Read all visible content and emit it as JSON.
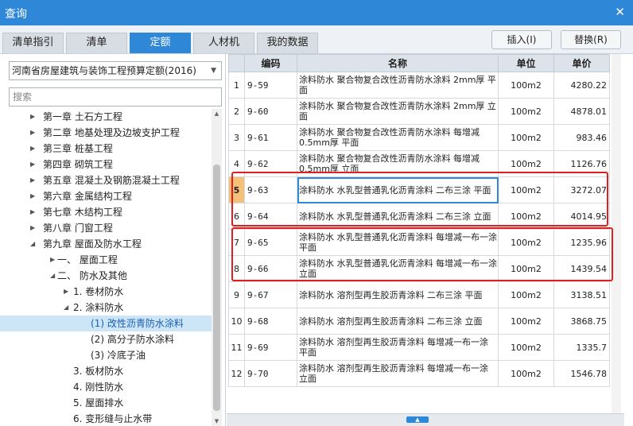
{
  "window": {
    "title": "查询",
    "close_glyph": "✕"
  },
  "tabs": [
    {
      "label": "清单指引",
      "active": false
    },
    {
      "label": "清单",
      "active": false
    },
    {
      "label": "定额",
      "active": true
    },
    {
      "label": "人材机",
      "active": false
    },
    {
      "label": "我的数据",
      "active": false
    }
  ],
  "toolbar": {
    "insert_label": "插入(I)",
    "replace_label": "替换(R)"
  },
  "left": {
    "quota_book": "河南省房屋建筑与装饰工程预算定额(2016)",
    "search_placeholder": "搜索",
    "tree": [
      {
        "label": "第一章 土石方工程",
        "twisty": "▶",
        "level": 0
      },
      {
        "label": "第二章 地基处理及边坡支护工程",
        "twisty": "▶",
        "level": 0
      },
      {
        "label": "第三章 桩基工程",
        "twisty": "▶",
        "level": 0
      },
      {
        "label": "第四章 砌筑工程",
        "twisty": "▶",
        "level": 0
      },
      {
        "label": "第五章 混凝土及钢筋混凝土工程",
        "twisty": "▶",
        "level": 0
      },
      {
        "label": "第六章 金属结构工程",
        "twisty": "▶",
        "level": 0
      },
      {
        "label": "第七章 木结构工程",
        "twisty": "▶",
        "level": 0
      },
      {
        "label": "第八章 门窗工程",
        "twisty": "▶",
        "level": 0
      },
      {
        "label": "第九章 屋面及防水工程",
        "twisty": "◢",
        "level": 0
      },
      {
        "label": "一、 屋面工程",
        "twisty": "▶",
        "level": 1
      },
      {
        "label": "二、 防水及其他",
        "twisty": "◢",
        "level": 1
      },
      {
        "label": "1. 卷材防水",
        "twisty": "▶",
        "level": 2
      },
      {
        "label": "2. 涂料防水",
        "twisty": "◢",
        "level": 2
      },
      {
        "label": "(1) 改性沥青防水涂料",
        "twisty": "",
        "level": 3,
        "selected": true
      },
      {
        "label": "(2) 高分子防水涂料",
        "twisty": "",
        "level": 3
      },
      {
        "label": "(3) 冷底子油",
        "twisty": "",
        "level": 3
      },
      {
        "label": "3. 板材防水",
        "twisty": "",
        "level": 2
      },
      {
        "label": "4. 刚性防水",
        "twisty": "",
        "level": 2
      },
      {
        "label": "5. 屋面排水",
        "twisty": "",
        "level": 2
      },
      {
        "label": "6. 变形缝与止水带",
        "twisty": "",
        "level": 2
      }
    ]
  },
  "grid": {
    "headers": [
      "",
      "编码",
      "名称",
      "单位",
      "单价"
    ],
    "rows": [
      {
        "no": "1",
        "code": "9-59",
        "name": "涂料防水 聚合物复合改性沥青防水涂料 2mm厚 平面",
        "unit": "100m2",
        "price": "4280.22"
      },
      {
        "no": "2",
        "code": "9-60",
        "name": "涂料防水 聚合物复合改性沥青防水涂料 2mm厚 立面",
        "unit": "100m2",
        "price": "4878.01"
      },
      {
        "no": "3",
        "code": "9-61",
        "name": "涂料防水 聚合物复合改性沥青防水涂料 每增减0.5mm厚 平面",
        "unit": "100m2",
        "price": "983.46"
      },
      {
        "no": "4",
        "code": "9-62",
        "name": "涂料防水 聚合物复合改性沥青防水涂料 每增减0.5mm厚 立面",
        "unit": "100m2",
        "price": "1126.76"
      },
      {
        "no": "5",
        "code": "9-63",
        "name": "涂料防水 水乳型普通乳化沥青涂料 二布三涂 平面",
        "unit": "100m2",
        "price": "3272.07"
      },
      {
        "no": "6",
        "code": "9-64",
        "name": "涂料防水 水乳型普通乳化沥青涂料 二布三涂 立面",
        "unit": "100m2",
        "price": "4014.95"
      },
      {
        "no": "7",
        "code": "9-65",
        "name": "涂料防水 水乳型普通乳化沥青涂料 每增减一布一涂 平面",
        "unit": "100m2",
        "price": "1235.96"
      },
      {
        "no": "8",
        "code": "9-66",
        "name": "涂料防水 水乳型普通乳化沥青涂料 每增减一布一涂 立面",
        "unit": "100m2",
        "price": "1439.54"
      },
      {
        "no": "9",
        "code": "9-67",
        "name": "涂料防水 溶剂型再生胶沥青涂料 二布三涂 平面",
        "unit": "100m2",
        "price": "3138.51"
      },
      {
        "no": "10",
        "code": "9-68",
        "name": "涂料防水 溶剂型再生胶沥青涂料 二布三涂 立面",
        "unit": "100m2",
        "price": "3868.75"
      },
      {
        "no": "11",
        "code": "9-69",
        "name": "涂料防水 溶剂型再生胶沥青涂料 每增减一布一涂 平面",
        "unit": "100m2",
        "price": "1335.7"
      },
      {
        "no": "12",
        "code": "9-70",
        "name": "涂料防水 溶剂型再生胶沥青涂料 每增减一布一涂 立面",
        "unit": "100m2",
        "price": "1546.78"
      }
    ]
  }
}
